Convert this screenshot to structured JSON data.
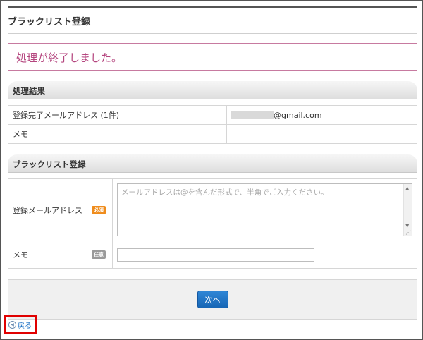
{
  "page": {
    "title": "ブラックリスト登録"
  },
  "message": "処理が終了しました。",
  "result": {
    "heading": "処理結果",
    "rows": [
      {
        "label": "登録完了メールアドレス (1件)",
        "value": "@gmail.com"
      },
      {
        "label": "メモ",
        "value": ""
      }
    ]
  },
  "registration": {
    "heading": "ブラックリスト登録",
    "email": {
      "label": "登録メールアドレス",
      "badge": "必須",
      "placeholder": "メールアドレスは@を含んだ形式で、半角でご入力ください。"
    },
    "memo": {
      "label": "メモ",
      "badge": "任意",
      "value": ""
    }
  },
  "actions": {
    "next_label": "次へ"
  },
  "back": {
    "label": "戻る"
  },
  "colors": {
    "message_text": "#b5467f",
    "message_border": "#c77aa0",
    "button": "#1f74c6",
    "required_badge": "#ef8c1c",
    "optional_badge": "#9a9a9a",
    "highlight": "#e00000"
  }
}
